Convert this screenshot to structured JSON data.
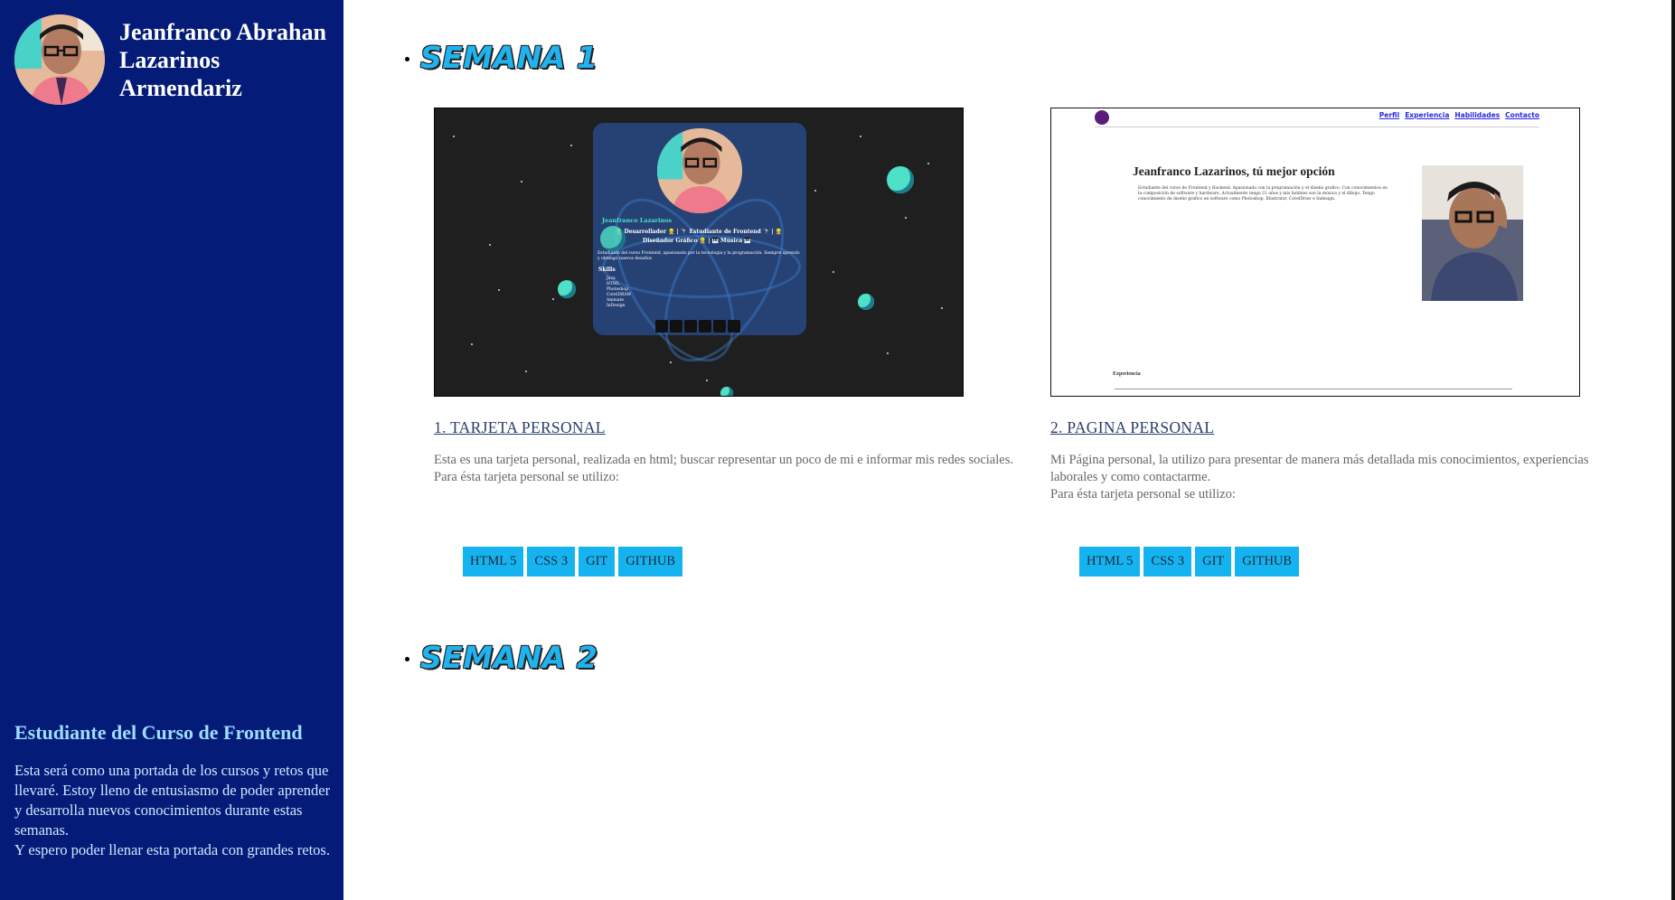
{
  "sidebar": {
    "name": "Jeanfranco Abrahan Lazarinos Armendariz",
    "about_title": "Estudiante del Curso de Frontend",
    "about_text_1": "Esta será como una portada de los cursos y retos que llevaré. Estoy lleno de entusiasmo de poder aprender y desarrolla nuevos conocimientos durante estas semanas.",
    "about_text_2": "Y espero poder llenar esta portada con grandes retos.",
    "bg_color": "#041c78"
  },
  "weeks": [
    {
      "title": "SEMANA 1"
    },
    {
      "title": "SEMANA 2"
    }
  ],
  "projects": [
    {
      "title": "1. TARJETA PERSONAL",
      "desc_1": "Esta es una tarjeta personal, realizada en html; buscar representar un poco de mi e informar mis redes sociales.",
      "desc_2": "Para ésta tarjeta personal se utilizo:",
      "tags": [
        "HTML 5",
        "CSS 3",
        "GIT",
        "GITHUB"
      ],
      "preview": {
        "name": "Jeanfranco Lazarinos",
        "roles": "👷 Desarrollador 👷 | 🔭 Estudiante de Frontend 🔭 | 👷",
        "roles_2": "Diseñador Gráfico 👷 | 🎹 Música 🎹",
        "bio": "Estudiante del curso Frontend, apasionado por la tecnologia y la programación. Siempre aprendo y obtengo nuevos desafios",
        "skills_title": "Skills",
        "skills": [
          "Java",
          "HTML",
          "Photoshop",
          "CorelDRAW",
          "Animate",
          "InDesign"
        ]
      }
    },
    {
      "title": "2. PAGINA PERSONAL",
      "desc_1": "Mi Página personal, la utilizo para presentar de manera más detallada mis conocimientos, experiencias laborales y como contactarme.",
      "desc_2": "Para ésta tarjeta personal se utilizo:",
      "tags": [
        "HTML 5",
        "CSS 3",
        "GIT",
        "GITHUB"
      ],
      "preview": {
        "nav": [
          "Perfil",
          "Experiencia",
          "Habilidades",
          "Contacto"
        ],
        "heading": "Jeanfranco Lazarinos, tú mejor opción",
        "text": "Estudiante del curso de Frontend y Backend. Apasionado con la programación y el diseño grafico. Con conocimientos en la composición de software y hardware. Actualmente tengo 21 años y mis hobbies son la música y el dibujo. Tengo conocimiento de diseño grafico en software como Photoshop, Illustrator, CorelDraw e Indesign.",
        "section": "Experiencia"
      }
    }
  ],
  "colors": {
    "accent": "#15b4f0",
    "heading": "#1fb3ef",
    "link": "#2a3d6a"
  }
}
